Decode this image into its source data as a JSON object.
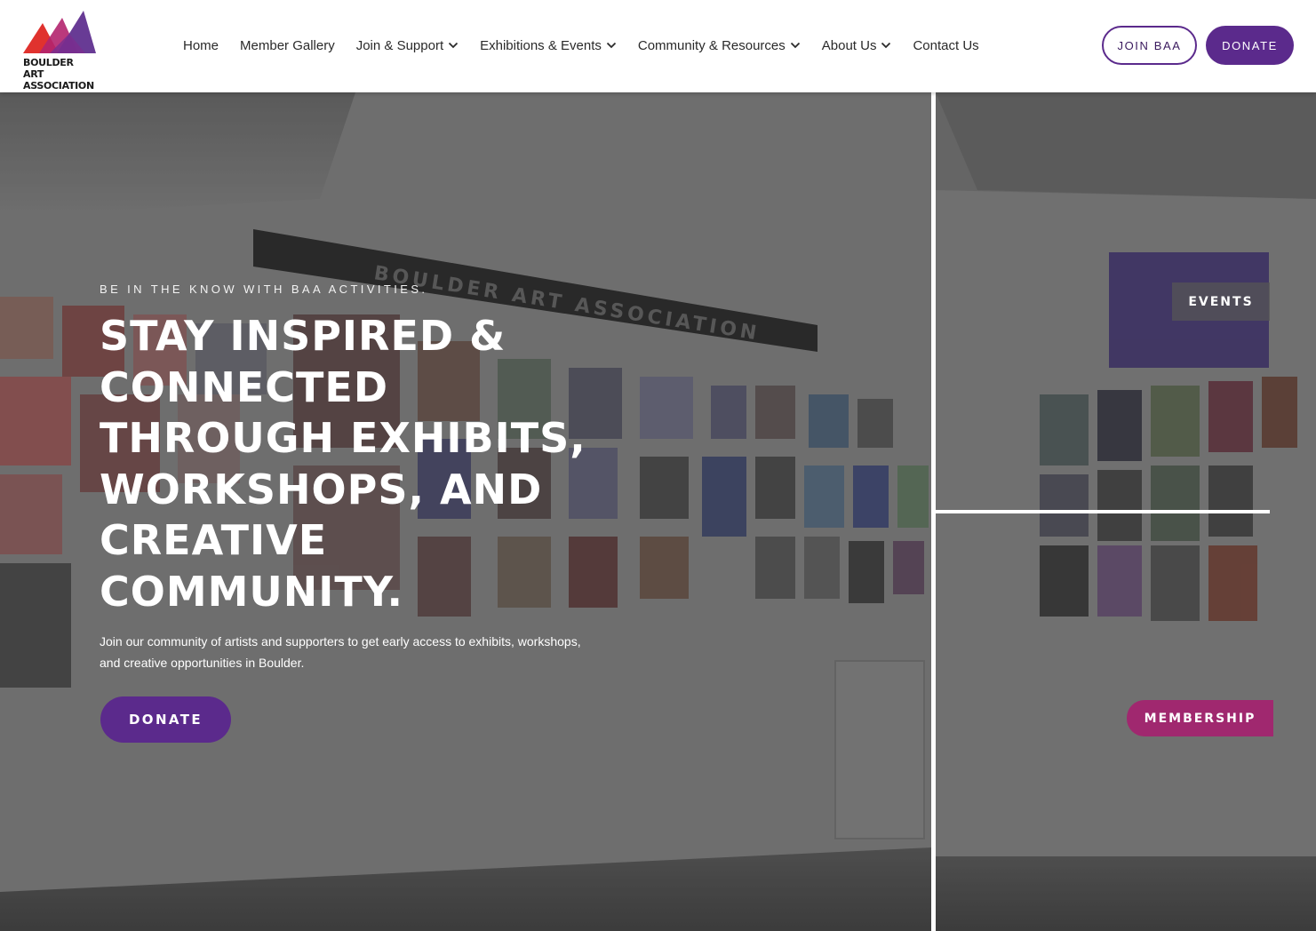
{
  "brand": {
    "logo_line1": "BOULDER ART",
    "logo_line2": "ASSOCIATION",
    "colors": {
      "purple": "#5b2a8c",
      "magenta": "#a0286f",
      "red": "#e0322e"
    }
  },
  "nav": {
    "items": [
      {
        "label": "Home",
        "has_dropdown": false
      },
      {
        "label": "Member Gallery",
        "has_dropdown": false
      },
      {
        "label": "Join & Support",
        "has_dropdown": true,
        "icon": "chevron-down-icon"
      },
      {
        "label": "Exhibitions & Events",
        "has_dropdown": true,
        "icon": "chevron-down-icon"
      },
      {
        "label": "Community & Resources",
        "has_dropdown": true,
        "icon": "chevron-down-icon"
      },
      {
        "label": "About Us",
        "has_dropdown": true,
        "icon": "chevron-down-icon"
      },
      {
        "label": "Contact Us",
        "has_dropdown": false
      }
    ]
  },
  "header_buttons": {
    "join_label": "JOIN BAA",
    "donate_label": "DONATE"
  },
  "hero": {
    "kicker": "BE IN THE KNOW WITH BAA ACTIVITIES.",
    "headline": "STAY INSPIRED & CONNECTED THROUGH EXHIBITS, WORKSHOPS, AND CREATIVE COMMUNITY.",
    "subcopy": "Join our community of artists and supporters to get early access to exhibits, workshops, and creative opportunities in Boulder.",
    "donate_label": "DONATE"
  },
  "side_tiles": {
    "events_label": "EVENTS",
    "membership_label": "MEMBERSHIP"
  },
  "gallery_photo": {
    "wall_sign": "BOULDER ART ASSOCIATION"
  }
}
